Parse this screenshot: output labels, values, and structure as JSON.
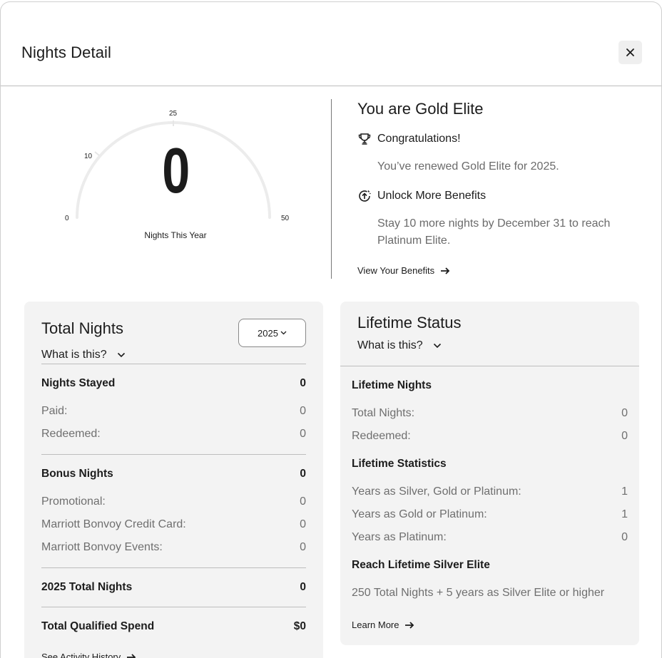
{
  "modal": {
    "title": "Nights Detail",
    "close_icon": "close-icon"
  },
  "gauge": {
    "value": "0",
    "caption": "Nights This Year",
    "ticks": [
      "0",
      "10",
      "25",
      "50"
    ],
    "nights": 0,
    "max": 50,
    "track_color": "#ececec"
  },
  "status": {
    "heading": "You are Gold Elite",
    "rows": [
      {
        "icon": "trophy-icon",
        "title": "Congratulations!",
        "text": "You’ve renewed Gold Elite for 2025."
      },
      {
        "icon": "unlock-arrow-icon",
        "title": "Unlock More Benefits",
        "text": "Stay 10 more nights by December 31 to reach Platinum Elite."
      }
    ],
    "link_label": "View Your Benefits"
  },
  "total_nights": {
    "title": "Total Nights",
    "what_is_label": "What is this?",
    "year_value": "2025",
    "nights_stayed": {
      "label": "Nights Stayed",
      "value": "0"
    },
    "paid": {
      "label": "Paid:",
      "value": "0"
    },
    "redeemed": {
      "label": "Redeemed:",
      "value": "0"
    },
    "bonus_nights": {
      "label": "Bonus Nights",
      "value": "0"
    },
    "promotional": {
      "label": "Promotional:",
      "value": "0"
    },
    "credit_card": {
      "label": "Marriott Bonvoy Credit Card:",
      "value": "0"
    },
    "events": {
      "label": "Marriott Bonvoy Events:",
      "value": "0"
    },
    "year_total": {
      "label": "2025 Total Nights",
      "value": "0"
    },
    "qualified_spend": {
      "label": "Total Qualified Spend",
      "value": "$0"
    },
    "history_link": "See Activity History"
  },
  "lifetime": {
    "title": "Lifetime Status",
    "what_is_label": "What is this?",
    "nights_label": "Lifetime Nights",
    "total_nights": {
      "label": "Total Nights:",
      "value": "0"
    },
    "redeemed": {
      "label": "Redeemed:",
      "value": "0"
    },
    "statistics_label": "Lifetime Statistics",
    "years_silver_gold_platinum": {
      "label": "Years as Silver, Gold or Platinum:",
      "value": "1"
    },
    "years_gold_platinum": {
      "label": "Years as Gold or Platinum:",
      "value": "1"
    },
    "years_platinum": {
      "label": "Years as Platinum:",
      "value": "0"
    },
    "reach_label": "Reach Lifetime Silver Elite",
    "reach_text": "250 Total Nights + 5 years as Silver Elite or higher",
    "learn_more": "Learn More"
  }
}
